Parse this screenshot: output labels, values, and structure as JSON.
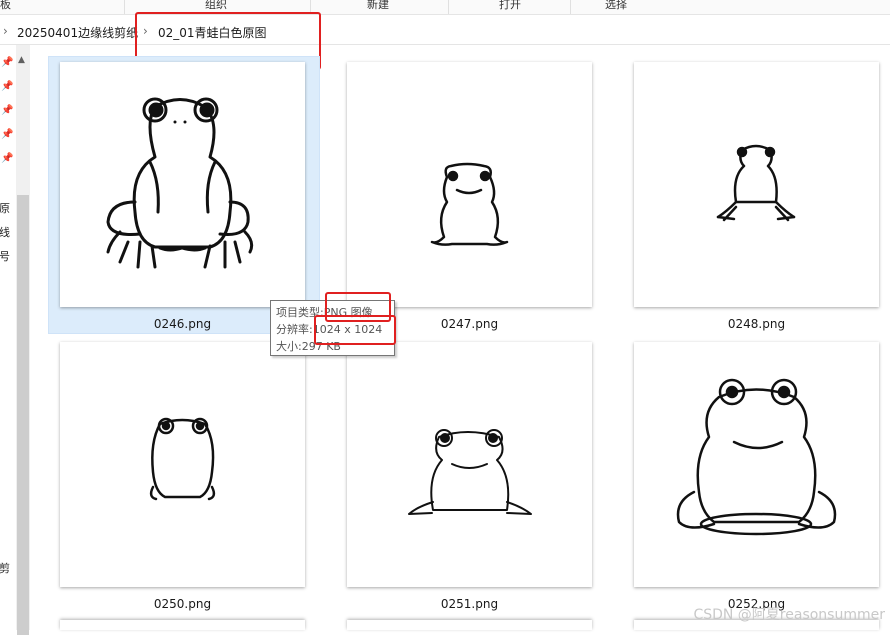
{
  "ribbon": {
    "clipboard": "板",
    "organize": "组织",
    "new": "新建",
    "open": "打开",
    "select": "选择"
  },
  "breadcrumb": {
    "parent": "20250401边缘线剪纸",
    "current": "02_01青蛙白色原图"
  },
  "nav": {
    "labels": [
      "原",
      "线",
      "号",
      "剪"
    ]
  },
  "files": [
    {
      "name": "0246.png"
    },
    {
      "name": "0247.png"
    },
    {
      "name": "0248.png"
    },
    {
      "name": "0250.png"
    },
    {
      "name": "0251.png"
    },
    {
      "name": "0252.png"
    }
  ],
  "tooltip": {
    "type_label": "项目类型:",
    "type_value": "PNG 图像",
    "res_label": "分辨率:",
    "res_value": "1024 x 1024",
    "size_label": "大小:",
    "size_value": "297 KB"
  },
  "watermark": "CSDN @阿夏reasonsummer",
  "colors": {
    "highlight": "#e02020",
    "selection": "#dcecfb"
  }
}
